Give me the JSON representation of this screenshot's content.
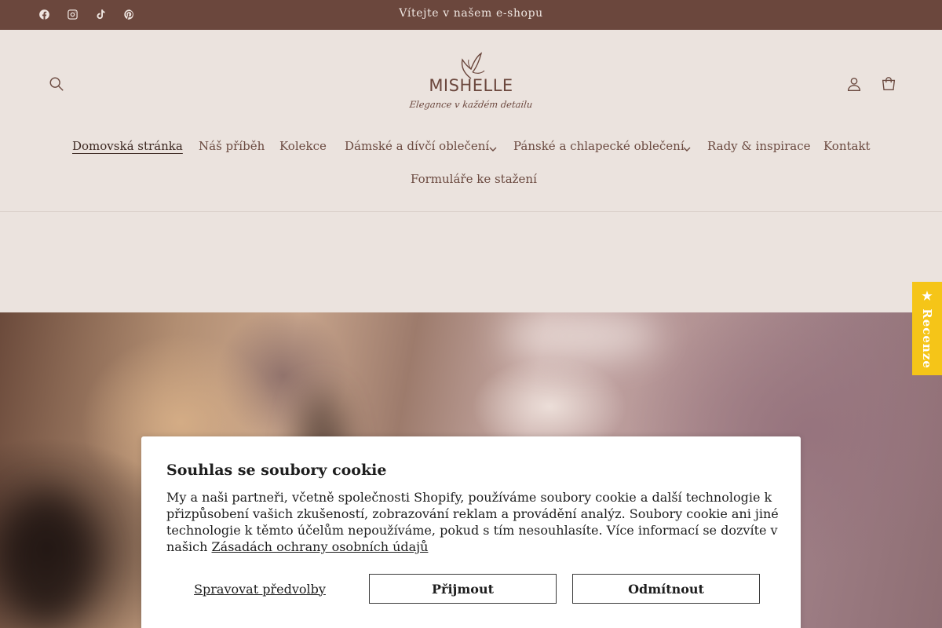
{
  "topbar": {
    "announcement": "Vítejte v našem e-shopu",
    "social": [
      {
        "icon": "facebook-icon"
      },
      {
        "icon": "instagram-icon"
      },
      {
        "icon": "tiktok-icon"
      },
      {
        "icon": "pinterest-icon"
      }
    ]
  },
  "header": {
    "logo": {
      "name": "MISHELLE",
      "tagline": "Elegance v každém detailu"
    },
    "icons": {
      "search": "search-icon",
      "account": "user-icon",
      "cart": "cart-icon"
    }
  },
  "nav": {
    "items": [
      {
        "label": "Domovská stránka",
        "active": true
      },
      {
        "label": "Náš příběh"
      },
      {
        "label": "Kolekce"
      },
      {
        "label": "Dámské a dívčí oblečení",
        "has_dropdown": true
      },
      {
        "label": "Pánské a chlapecké oblečení",
        "has_dropdown": true
      },
      {
        "label": "Rady & inspirace"
      },
      {
        "label": "Kontakt"
      },
      {
        "label": "Formuláře ke stažení"
      }
    ]
  },
  "reviews_tab": {
    "label": "★ Recenze"
  },
  "cookie": {
    "title": "Souhlas se soubory cookie",
    "text": "My a naši partneři, včetně společnosti Shopify, používáme soubory cookie a další technologie k přizpůsobení vašich zkušeností, zobrazování reklam a provádění analýz. Soubory cookie ani jiné technologie k těmto účelům nepoužíváme, pokud s tím nesouhlasíte. Více informací se dozvíte v našich",
    "link": "Zásadách ochrany osobních údajů",
    "manage": "Spravovat předvolby",
    "accept": "Přijmout",
    "decline": "Odmítnout"
  },
  "colors": {
    "topbar": "#6b473d",
    "background": "#ebe3de",
    "reviews_tab": "#f5c518"
  }
}
